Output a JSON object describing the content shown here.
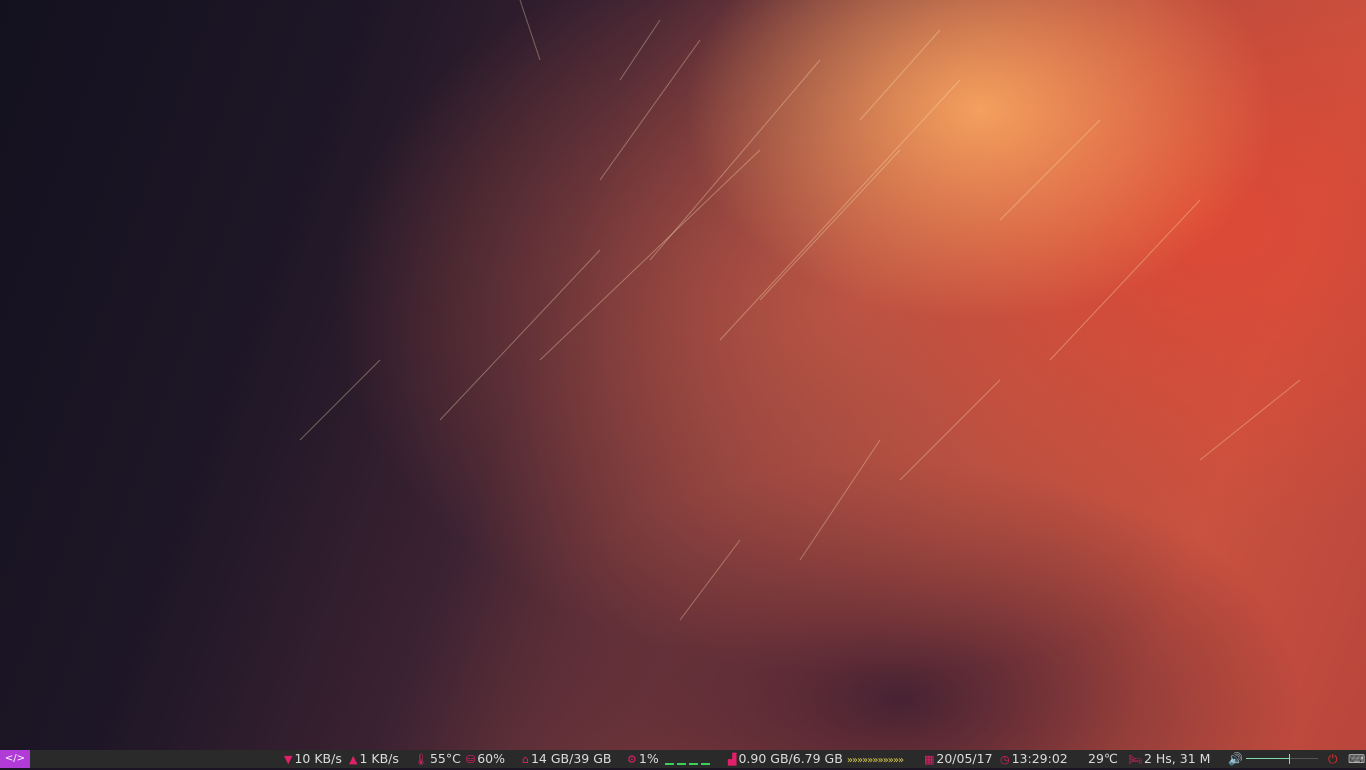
{
  "panel": {
    "menu_label": "</>",
    "net_down": "10 KB/s",
    "net_up": "1 KB/s",
    "cpu_temp": "55°C",
    "battery": "60%",
    "disk": "14 GB/39 GB",
    "cpu_load": "1%",
    "memory": "0.90 GB/6.79 GB",
    "memory_bar": "»»»»»»»»»»»",
    "date": "20/05/17",
    "time": "13:29:02",
    "weather": "29℃",
    "uptime": "2 Hs, 31 M",
    "volume_level": 0.6
  },
  "colors": {
    "panel_bg": "#2a2a2a",
    "menu_accent": "#b13bd6",
    "icon_accent": "#e0206a",
    "graph": "#3ad15a",
    "arrows": "#d8c84a"
  },
  "icons": [
    "down-arrow-icon",
    "up-arrow-icon",
    "thermometer-icon",
    "hdd-icon",
    "home-icon",
    "cogs-icon",
    "chart-icon",
    "calendar-icon",
    "clock-icon",
    "bed-icon",
    "speaker-icon",
    "power-icon",
    "keyboard-icon"
  ]
}
